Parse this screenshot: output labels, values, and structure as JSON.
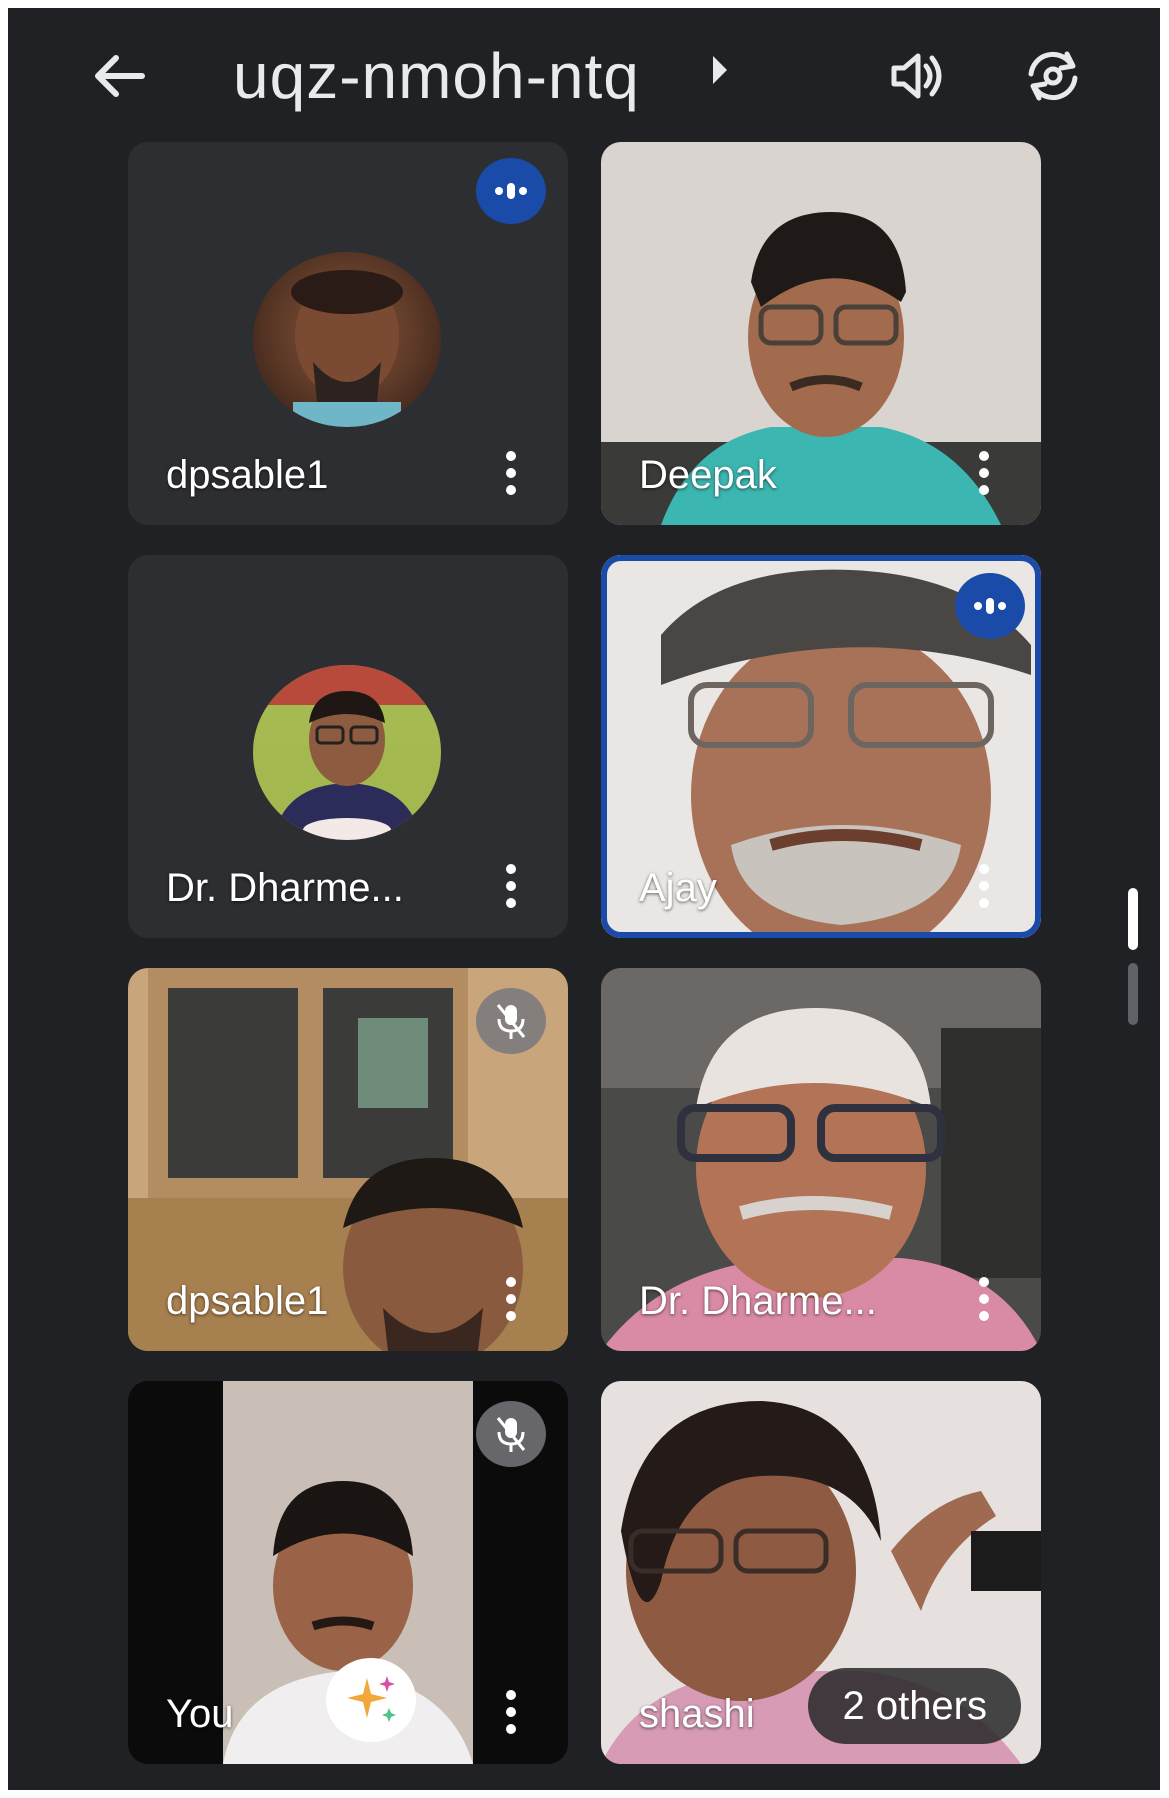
{
  "header": {
    "meeting_code": "uqz-nmoh-ntq",
    "icons": [
      "arrow-back-icon",
      "caret-right-icon",
      "volume-icon",
      "camera-flip-icon"
    ]
  },
  "participants": [
    {
      "name": "dpsable1",
      "state": "speaking",
      "display": "avatar"
    },
    {
      "name": "Deepak",
      "state": "video",
      "display": "video"
    },
    {
      "name": "Dr. Dharme...",
      "state": "idle",
      "display": "avatar"
    },
    {
      "name": "Ajay",
      "state": "speaking-active",
      "display": "video"
    },
    {
      "name": "dpsable1",
      "state": "muted",
      "display": "video"
    },
    {
      "name": "Dr. Dharme...",
      "state": "video",
      "display": "video"
    },
    {
      "name": "You",
      "state": "muted",
      "display": "video"
    },
    {
      "name": "shashi",
      "state": "video",
      "display": "video"
    }
  ],
  "others_chip": "2 others",
  "colors": {
    "background": "#202124",
    "tile": "#2d2e31",
    "accent": "#1a4ba8",
    "text": "#ffffff"
  }
}
